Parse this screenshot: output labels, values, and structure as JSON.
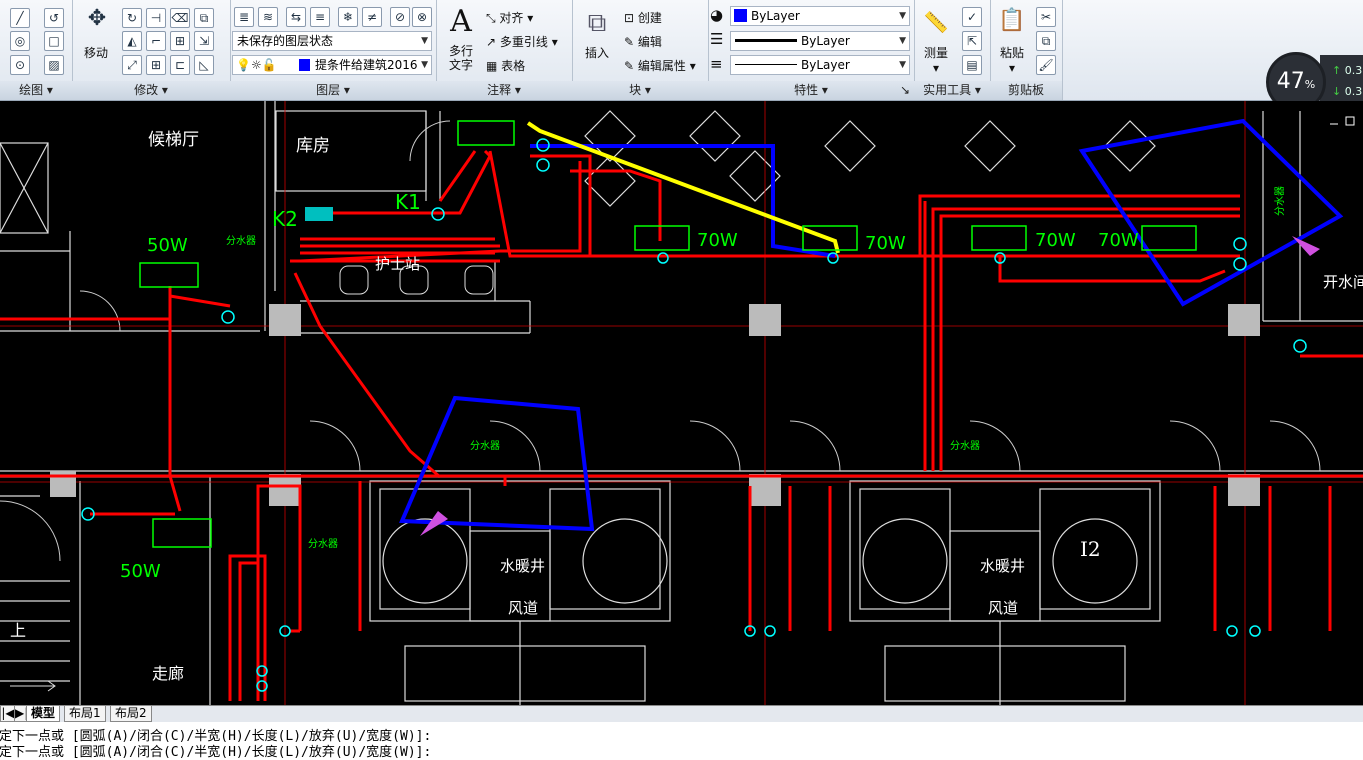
{
  "ribbon": {
    "panels": {
      "draw": "绘图",
      "modify": "修改",
      "layers": "图层",
      "annotation": "注释",
      "block": "块",
      "properties": "特性",
      "utilities": "实用工具",
      "clipboard": "剪贴板"
    },
    "move_label": "移动",
    "layer_state": "未保存的图层状态",
    "current_layer": "提条件给建筑2016",
    "mtext_label": "多行文字",
    "align_label": "对齐",
    "mleader_label": "多重引线",
    "table_label": "表格",
    "insert_label": "插入",
    "create_label": "创建",
    "edit_label": "编辑",
    "edit_attr_label": "编辑属性",
    "color_value": "ByLayer",
    "linetype_value": "ByLayer",
    "lineweight_value": "ByLayer",
    "measure_label": "测量",
    "paste_label": "粘贴"
  },
  "status_badge": {
    "percent": "47",
    "unit": "%",
    "up": "0.3",
    "down": "0.3"
  },
  "drawing": {
    "rooms": [
      "候梯厅",
      "库房",
      "护士站",
      "开水间",
      "水暖井",
      "风道",
      "水暖井",
      "风道",
      "走廊",
      "上"
    ],
    "tags": [
      "K1",
      "K2",
      "I2"
    ],
    "watts": [
      "50W",
      "50W",
      "70W",
      "70W",
      "70W",
      "70W"
    ],
    "distributor": "分水器"
  },
  "layout_tabs": [
    "模型",
    "布局1",
    "布局2"
  ],
  "command_lines": [
    "指定下一点或 [圆弧(A)/闭合(C)/半宽(H)/长度(L)/放弃(U)/宽度(W)]:",
    "指定下一点或 [圆弧(A)/闭合(C)/半宽(H)/长度(L)/放弃(U)/宽度(W)]:"
  ],
  "colors": {
    "pipe": "#ff0000",
    "highlight_blue": "#0000ff",
    "highlight_yellow": "#ffff00",
    "arrow": "#d050e0",
    "equipment": "#00ff00",
    "label": "#00ffff"
  }
}
